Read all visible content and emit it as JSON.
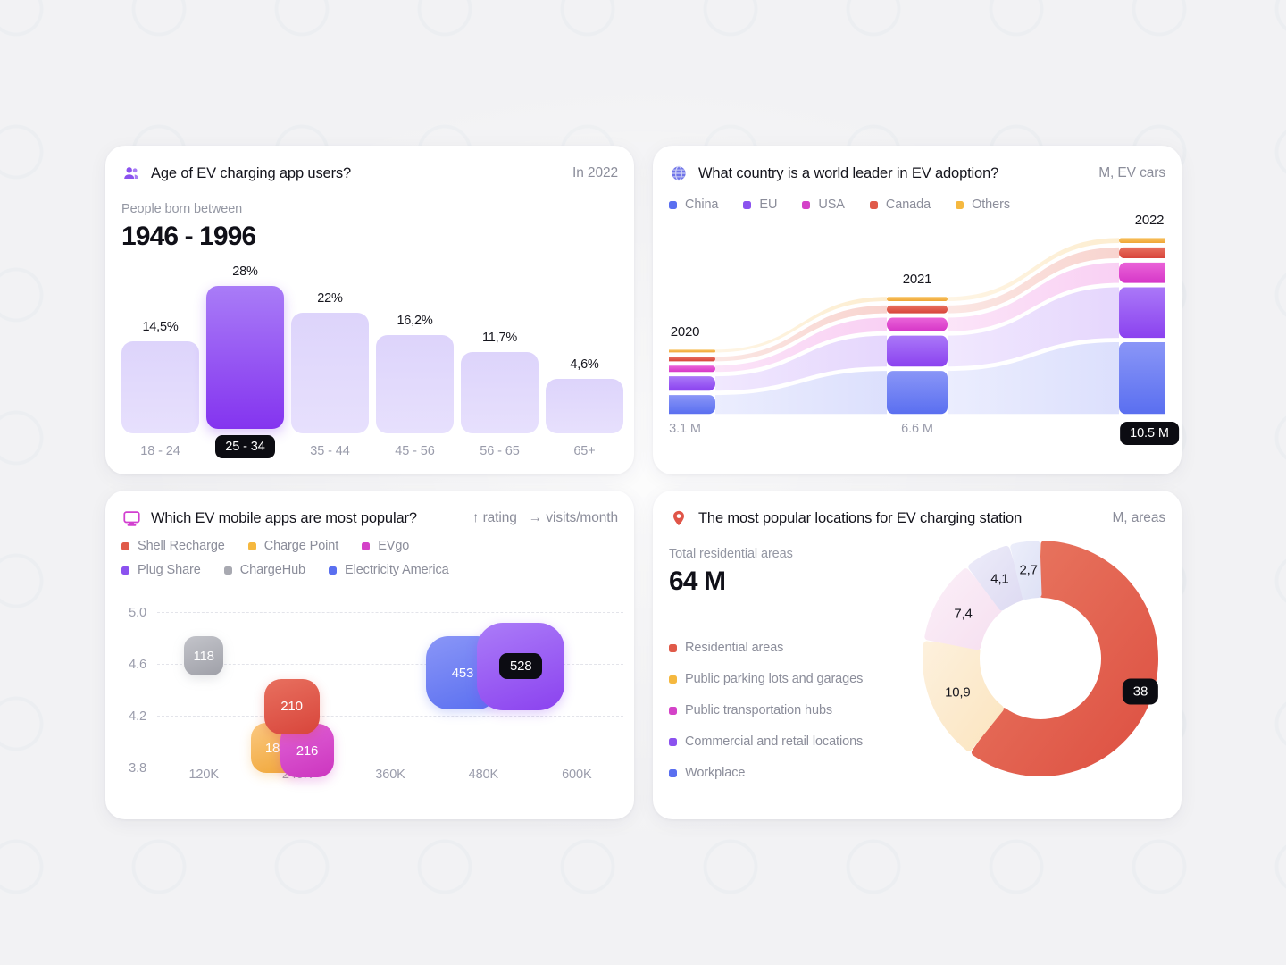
{
  "cards": {
    "age": {
      "icon": "users-icon",
      "title": "Age of EV charging app users?",
      "unit": "In 2022",
      "sub_label": "People born between",
      "big_value": "1946 - 1996"
    },
    "country": {
      "icon": "globe-icon",
      "title": "What country is a world leader in EV adoption?",
      "unit": "M, EV cars"
    },
    "apps": {
      "icon": "monitor-icon",
      "title": "Which EV mobile apps are most popular?",
      "unit_y": "↑ rating",
      "unit_x": "→ visits/month"
    },
    "locations": {
      "icon": "map-pin-icon",
      "title": "The most popular locations for EV charging station",
      "unit": "M, areas",
      "sub_label": "Total residential areas",
      "big_value": "64 M"
    }
  },
  "chart_data": [
    {
      "id": "age-distribution",
      "type": "bar",
      "title": "Age of EV charging app users?",
      "xlabel": "",
      "ylabel": "",
      "unit": "%",
      "categories": [
        "18 - 24",
        "25 - 34",
        "35 - 44",
        "45 - 56",
        "56 - 65",
        "65+"
      ],
      "value_labels": [
        "14,5%",
        "28%",
        "22%",
        "16,2%",
        "11,7%",
        "4,6%"
      ],
      "values": [
        14.5,
        28,
        22,
        16.2,
        11.7,
        4.6
      ],
      "active_index": 1,
      "colors": {
        "inactive_top": "#ddd4fb",
        "inactive_bottom": "#e7e0fd",
        "active_top": "#a97cf7",
        "active_bottom": "#8434ef",
        "badge": "#0c0c12"
      }
    },
    {
      "id": "ev-adoption-by-country",
      "type": "area",
      "title": "What country is a world leader in EV adoption?",
      "unit": "M, EV cars",
      "categories": [
        "2020",
        "2021",
        "2022"
      ],
      "totals": [
        "3.1 M",
        "6.6 M",
        "10.5 M"
      ],
      "active_total_index": 2,
      "series": [
        {
          "name": "China",
          "color": "#5a6ff0",
          "color2": "#8a96f7",
          "values": [
            1.25,
            2.85,
            4.75
          ]
        },
        {
          "name": "EU",
          "color": "#8b42ef",
          "color2": "#aa78f8",
          "values": [
            0.95,
            2.05,
            3.35
          ]
        },
        {
          "name": "USA",
          "color": "#d637c8",
          "color2": "#ea63d8",
          "values": [
            0.42,
            0.9,
            1.35
          ]
        },
        {
          "name": "Canada",
          "color": "#d8453b",
          "color2": "#e8705f",
          "values": [
            0.3,
            0.52,
            0.72
          ]
        },
        {
          "name": "Others",
          "color": "#f0a637",
          "color2": "#f8c463",
          "values": [
            0.18,
            0.28,
            0.33
          ]
        }
      ]
    },
    {
      "id": "ev-mobile-apps",
      "type": "scatter",
      "title": "Which EV mobile apps are most popular?",
      "xlabel": "visits/month",
      "ylabel": "rating",
      "ylim": [
        3.8,
        5.0
      ],
      "y_ticks": [
        "3.8",
        "4.2",
        "4.6",
        "5.0"
      ],
      "xlim": [
        60000,
        660000
      ],
      "x_ticks": [
        "120K",
        "240K",
        "360K",
        "480K",
        "600K"
      ],
      "x_tick_values": [
        120000,
        240000,
        360000,
        480000,
        600000
      ],
      "points": [
        {
          "name": "ChargeHub",
          "label": "118",
          "x": 120000,
          "y": 4.66,
          "size": 44,
          "color": "#9fa0a8",
          "color2": "#c3c4ca",
          "active": false
        },
        {
          "name": "Shell Recharge",
          "label": "210",
          "x": 233000,
          "y": 4.27,
          "size": 62,
          "color": "#d8453b",
          "color2": "#e8705f",
          "active": false
        },
        {
          "name": "Charge Point",
          "label": "189",
          "x": 213000,
          "y": 3.95,
          "size": 56,
          "color": "#f0a637",
          "color2": "#fbc982",
          "active": false
        },
        {
          "name": "EVgo",
          "label": "216",
          "x": 253000,
          "y": 3.93,
          "size": 60,
          "color": "#cc35bf",
          "color2": "#e062d6",
          "active": false
        },
        {
          "name": "Electricity America",
          "label": "453",
          "x": 453000,
          "y": 4.53,
          "size": 82,
          "color": "#5a6ff0",
          "color2": "#8a96f7",
          "active": false
        },
        {
          "name": "Plug Share",
          "label": "528",
          "x": 528000,
          "y": 4.58,
          "size": 98,
          "color": "#8b42ef",
          "color2": "#ab7cf8",
          "active": true
        }
      ],
      "legend": [
        {
          "name": "Shell Recharge",
          "color": "#e05a49"
        },
        {
          "name": "Charge Point",
          "color": "#f5b83f"
        },
        {
          "name": "EVgo",
          "color": "#d442c8"
        },
        {
          "name": "Plug Share",
          "color": "#8b52ef"
        },
        {
          "name": "ChargeHub",
          "color": "#a8a9b1"
        },
        {
          "name": "Electricity America",
          "color": "#5a6ff0"
        }
      ]
    },
    {
      "id": "ev-charging-locations",
      "type": "pie",
      "title": "The most popular locations for EV charging station",
      "unit": "M, areas",
      "total_label": "Total residential areas",
      "total_value": "64 M",
      "labels": [
        "Residential areas",
        "Public parking lots and garages",
        "Public transportation hubs",
        "Commercial and retail locations",
        "Workplace"
      ],
      "value_labels": [
        "38",
        "10,9",
        "7,4",
        "4,1",
        "2,7"
      ],
      "values": [
        38,
        10.9,
        7.4,
        4.1,
        2.7
      ],
      "slice_colors": [
        "#dd4f41",
        "#fbe5c0",
        "#f6e0f0",
        "#dedbf2",
        "#dfe2f5"
      ],
      "slice_colors2": [
        "#e97a63",
        "#fdf0dc",
        "#fbeff8",
        "#ecebf9",
        "#ebedfa"
      ],
      "legend_colors": [
        "#e05a49",
        "#f5b83f",
        "#d442c8",
        "#8b52ef",
        "#5a6ff0"
      ],
      "active_index": 0
    }
  ],
  "legends": {
    "country": [
      {
        "name": "China",
        "color": "#5a6ff0"
      },
      {
        "name": "EU",
        "color": "#8b52ef"
      },
      {
        "name": "USA",
        "color": "#d442c8"
      },
      {
        "name": "Canada",
        "color": "#e05a49"
      },
      {
        "name": "Others",
        "color": "#f5b83f"
      }
    ]
  }
}
